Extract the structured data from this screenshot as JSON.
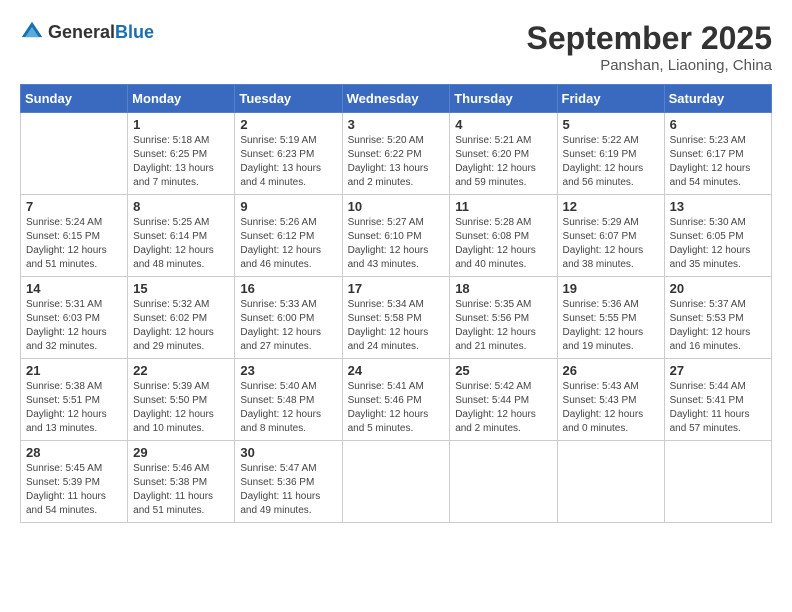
{
  "logo": {
    "general": "General",
    "blue": "Blue"
  },
  "title": {
    "month_year": "September 2025",
    "location": "Panshan, Liaoning, China"
  },
  "headers": [
    "Sunday",
    "Monday",
    "Tuesday",
    "Wednesday",
    "Thursday",
    "Friday",
    "Saturday"
  ],
  "weeks": [
    [
      {
        "day": "",
        "sunrise": "",
        "sunset": "",
        "daylight": ""
      },
      {
        "day": "1",
        "sunrise": "Sunrise: 5:18 AM",
        "sunset": "Sunset: 6:25 PM",
        "daylight": "Daylight: 13 hours and 7 minutes."
      },
      {
        "day": "2",
        "sunrise": "Sunrise: 5:19 AM",
        "sunset": "Sunset: 6:23 PM",
        "daylight": "Daylight: 13 hours and 4 minutes."
      },
      {
        "day": "3",
        "sunrise": "Sunrise: 5:20 AM",
        "sunset": "Sunset: 6:22 PM",
        "daylight": "Daylight: 13 hours and 2 minutes."
      },
      {
        "day": "4",
        "sunrise": "Sunrise: 5:21 AM",
        "sunset": "Sunset: 6:20 PM",
        "daylight": "Daylight: 12 hours and 59 minutes."
      },
      {
        "day": "5",
        "sunrise": "Sunrise: 5:22 AM",
        "sunset": "Sunset: 6:19 PM",
        "daylight": "Daylight: 12 hours and 56 minutes."
      },
      {
        "day": "6",
        "sunrise": "Sunrise: 5:23 AM",
        "sunset": "Sunset: 6:17 PM",
        "daylight": "Daylight: 12 hours and 54 minutes."
      }
    ],
    [
      {
        "day": "7",
        "sunrise": "Sunrise: 5:24 AM",
        "sunset": "Sunset: 6:15 PM",
        "daylight": "Daylight: 12 hours and 51 minutes."
      },
      {
        "day": "8",
        "sunrise": "Sunrise: 5:25 AM",
        "sunset": "Sunset: 6:14 PM",
        "daylight": "Daylight: 12 hours and 48 minutes."
      },
      {
        "day": "9",
        "sunrise": "Sunrise: 5:26 AM",
        "sunset": "Sunset: 6:12 PM",
        "daylight": "Daylight: 12 hours and 46 minutes."
      },
      {
        "day": "10",
        "sunrise": "Sunrise: 5:27 AM",
        "sunset": "Sunset: 6:10 PM",
        "daylight": "Daylight: 12 hours and 43 minutes."
      },
      {
        "day": "11",
        "sunrise": "Sunrise: 5:28 AM",
        "sunset": "Sunset: 6:08 PM",
        "daylight": "Daylight: 12 hours and 40 minutes."
      },
      {
        "day": "12",
        "sunrise": "Sunrise: 5:29 AM",
        "sunset": "Sunset: 6:07 PM",
        "daylight": "Daylight: 12 hours and 38 minutes."
      },
      {
        "day": "13",
        "sunrise": "Sunrise: 5:30 AM",
        "sunset": "Sunset: 6:05 PM",
        "daylight": "Daylight: 12 hours and 35 minutes."
      }
    ],
    [
      {
        "day": "14",
        "sunrise": "Sunrise: 5:31 AM",
        "sunset": "Sunset: 6:03 PM",
        "daylight": "Daylight: 12 hours and 32 minutes."
      },
      {
        "day": "15",
        "sunrise": "Sunrise: 5:32 AM",
        "sunset": "Sunset: 6:02 PM",
        "daylight": "Daylight: 12 hours and 29 minutes."
      },
      {
        "day": "16",
        "sunrise": "Sunrise: 5:33 AM",
        "sunset": "Sunset: 6:00 PM",
        "daylight": "Daylight: 12 hours and 27 minutes."
      },
      {
        "day": "17",
        "sunrise": "Sunrise: 5:34 AM",
        "sunset": "Sunset: 5:58 PM",
        "daylight": "Daylight: 12 hours and 24 minutes."
      },
      {
        "day": "18",
        "sunrise": "Sunrise: 5:35 AM",
        "sunset": "Sunset: 5:56 PM",
        "daylight": "Daylight: 12 hours and 21 minutes."
      },
      {
        "day": "19",
        "sunrise": "Sunrise: 5:36 AM",
        "sunset": "Sunset: 5:55 PM",
        "daylight": "Daylight: 12 hours and 19 minutes."
      },
      {
        "day": "20",
        "sunrise": "Sunrise: 5:37 AM",
        "sunset": "Sunset: 5:53 PM",
        "daylight": "Daylight: 12 hours and 16 minutes."
      }
    ],
    [
      {
        "day": "21",
        "sunrise": "Sunrise: 5:38 AM",
        "sunset": "Sunset: 5:51 PM",
        "daylight": "Daylight: 12 hours and 13 minutes."
      },
      {
        "day": "22",
        "sunrise": "Sunrise: 5:39 AM",
        "sunset": "Sunset: 5:50 PM",
        "daylight": "Daylight: 12 hours and 10 minutes."
      },
      {
        "day": "23",
        "sunrise": "Sunrise: 5:40 AM",
        "sunset": "Sunset: 5:48 PM",
        "daylight": "Daylight: 12 hours and 8 minutes."
      },
      {
        "day": "24",
        "sunrise": "Sunrise: 5:41 AM",
        "sunset": "Sunset: 5:46 PM",
        "daylight": "Daylight: 12 hours and 5 minutes."
      },
      {
        "day": "25",
        "sunrise": "Sunrise: 5:42 AM",
        "sunset": "Sunset: 5:44 PM",
        "daylight": "Daylight: 12 hours and 2 minutes."
      },
      {
        "day": "26",
        "sunrise": "Sunrise: 5:43 AM",
        "sunset": "Sunset: 5:43 PM",
        "daylight": "Daylight: 12 hours and 0 minutes."
      },
      {
        "day": "27",
        "sunrise": "Sunrise: 5:44 AM",
        "sunset": "Sunset: 5:41 PM",
        "daylight": "Daylight: 11 hours and 57 minutes."
      }
    ],
    [
      {
        "day": "28",
        "sunrise": "Sunrise: 5:45 AM",
        "sunset": "Sunset: 5:39 PM",
        "daylight": "Daylight: 11 hours and 54 minutes."
      },
      {
        "day": "29",
        "sunrise": "Sunrise: 5:46 AM",
        "sunset": "Sunset: 5:38 PM",
        "daylight": "Daylight: 11 hours and 51 minutes."
      },
      {
        "day": "30",
        "sunrise": "Sunrise: 5:47 AM",
        "sunset": "Sunset: 5:36 PM",
        "daylight": "Daylight: 11 hours and 49 minutes."
      },
      {
        "day": "",
        "sunrise": "",
        "sunset": "",
        "daylight": ""
      },
      {
        "day": "",
        "sunrise": "",
        "sunset": "",
        "daylight": ""
      },
      {
        "day": "",
        "sunrise": "",
        "sunset": "",
        "daylight": ""
      },
      {
        "day": "",
        "sunrise": "",
        "sunset": "",
        "daylight": ""
      }
    ]
  ]
}
